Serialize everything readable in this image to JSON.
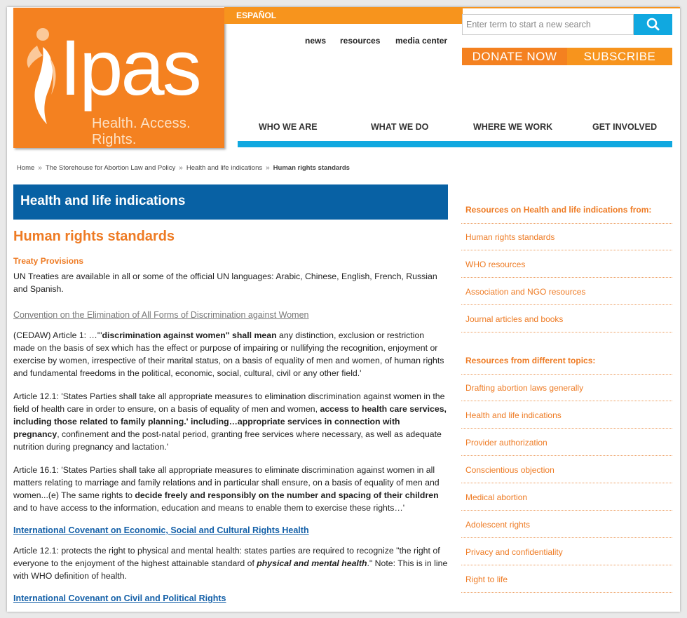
{
  "header": {
    "logo_text": "Ipas",
    "logo_tagline": "Health. Access. Rights.",
    "language_link": "ESPAÑOL",
    "util_nav": [
      "news",
      "resources",
      "media center"
    ],
    "search_placeholder": "Enter term to start a new search",
    "donate_label": "DONATE NOW",
    "subscribe_label": "SUBSCRIBE",
    "main_nav": [
      "WHO WE ARE",
      "WHAT WE DO",
      "WHERE WE WORK",
      "GET INVOLVED"
    ]
  },
  "breadcrumb": [
    "Home",
    "The Storehouse for Abortion Law and Policy",
    "Health and life indications",
    "Human rights standards"
  ],
  "main": {
    "banner": "Health and life indications",
    "title": "Human rights standards",
    "section_heading": "Treaty Provisions",
    "intro": "UN Treaties are available in all or some of the official UN languages: Arabic, Chinese, English, French, Russian and Spanish.",
    "cedaw_link": "Convention on the Elimination of All Forms of Discrimination against Women",
    "p1": {
      "a": "(CEDAW) Article 1: …'\"",
      "b": "discrimination against women\" shall mean",
      "c": " any distinction, exclusion or restriction made on the basis of sex which has the effect or purpose of impairing or nullifying the recognition, enjoyment or exercise by women, irrespective of their marital status, on a basis of equality of men and women, of human rights and fundamental freedoms in the political, economic, social, cultural, civil or any other field.'"
    },
    "p2": {
      "a": "Article 12.1: 'States Parties shall take all appropriate measures to elimination discrimination against women in the field of health care in order to ensure, on a basis of equality of men and women, ",
      "b": "access to health care services, including those related to family planning.' including…appropriate services in connection with pregnancy",
      "c": ", confinement and the post-natal period, granting free services where necessary, as well as adequate nutrition during pregnancy and lactation.'"
    },
    "p3": {
      "a": "Article 16.1: 'States Parties shall take all appropriate measures to eliminate discrimination against women in all matters relating to marriage and family relations and in particular shall ensure, on a basis of equality of men and women...(e) The same rights to ",
      "b": "decide freely and responsibly on the number and spacing of their children",
      "c": " and to have access to the information, education and means to enable them to exercise these rights…'"
    },
    "icescr_link": "International Covenant on Economic, Social and Cultural Rights Health",
    "p4": {
      "a": "Article 12.1: protects the right to physical and mental health: states parties are required to recognize \"the right of everyone to the enjoyment of the highest attainable standard of ",
      "b": "physical and mental health",
      "c": ".\" Note: This is in line with WHO definition of health."
    },
    "iccpr_link": "International Covenant on Civil and Political Rights"
  },
  "sidebar": {
    "heading1": "Resources on Health and life indications from:",
    "group1": [
      "Human rights standards",
      "WHO resources",
      "Association and NGO resources",
      "Journal articles and books"
    ],
    "heading2": "Resources from different topics:",
    "group2": [
      "Drafting abortion laws generally",
      "Health and life indications",
      "Provider authorization",
      "Conscientious objection",
      "Medical abortion",
      "Adolescent rights",
      "Privacy and confidentiality",
      "Right to life"
    ]
  },
  "colors": {
    "orange": "#f48120",
    "blue_banner": "#0861a4",
    "cyan": "#10a8e0"
  }
}
